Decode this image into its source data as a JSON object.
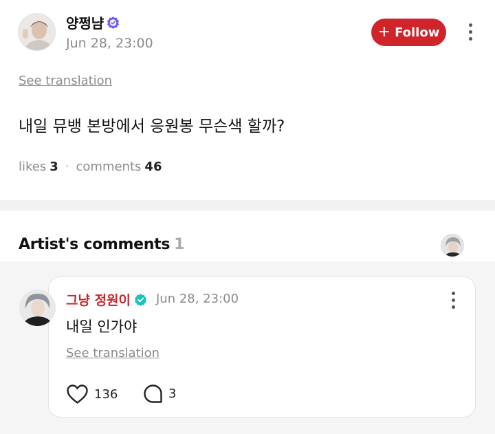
{
  "post": {
    "author": "양쩡냠",
    "timestamp": "Jun 28, 23:00",
    "follow_label": "Follow",
    "translate_label": "See translation",
    "body": "내일 뮤뱅 본방에서 응원봉 무슨색 할까?",
    "likes_label": "likes",
    "likes_count": "3",
    "comments_label": "comments",
    "comments_count": "46"
  },
  "artist_comments": {
    "title": "Artist's comments",
    "count": "1",
    "items": [
      {
        "author": "그냥 정원이",
        "timestamp": "Jun 28, 23:00",
        "body": "내일 인가야",
        "translate_label": "See translation",
        "like_count": "136",
        "reply_count": "3"
      }
    ]
  },
  "colors": {
    "follow_button": "#d0242b",
    "artist_name": "#c8262d",
    "verified_badge_post": "#6b5cf6",
    "verified_badge_artist": "#18c3c0"
  },
  "icons": [
    "verified-badge-icon",
    "plus-icon",
    "more-vertical-icon",
    "heart-icon",
    "comment-bubble-icon"
  ]
}
